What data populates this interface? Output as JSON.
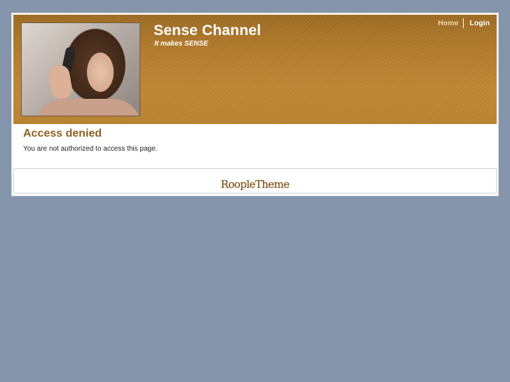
{
  "header": {
    "site_name": "Sense Channel",
    "slogan": "It makes SENSE",
    "nav": {
      "home_label": "Home",
      "login_label": "Login"
    }
  },
  "main": {
    "title": "Access denied",
    "message": "You are not authorized to access this page."
  },
  "footer": {
    "logo_text": "RoopleTheme"
  },
  "colors": {
    "page_background": "#8495ab",
    "header_accent": "#b8822f",
    "title_color": "#8f6122",
    "nav_home_color": "#f2d9a6"
  }
}
